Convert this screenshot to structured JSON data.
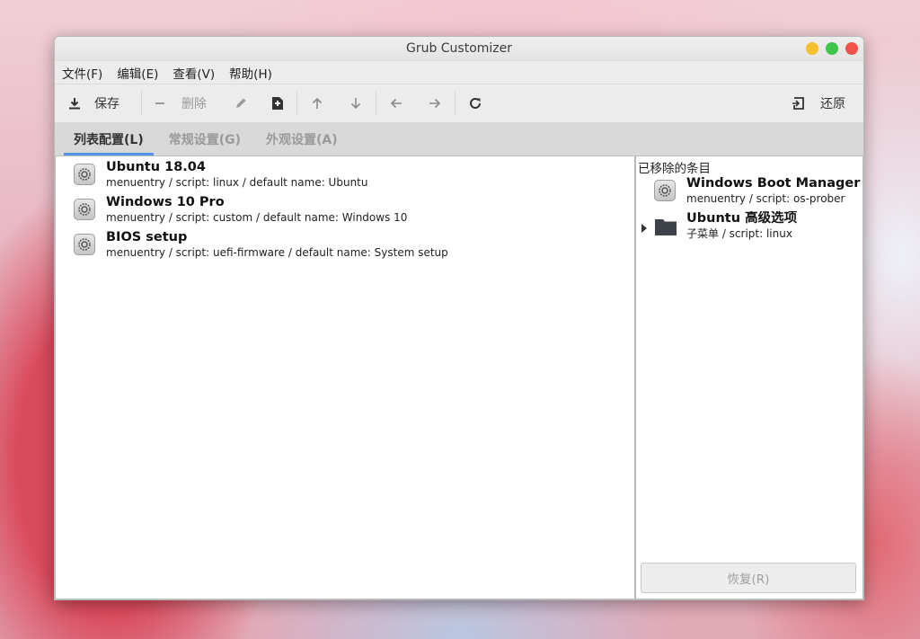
{
  "window": {
    "title": "Grub Customizer"
  },
  "menu": [
    "文件(F)",
    "编辑(E)",
    "查看(V)",
    "帮助(H)"
  ],
  "toolbar": {
    "save_label": "保存",
    "delete_label": "删除",
    "revert_label": "还原"
  },
  "tabs": [
    "列表配置(L)",
    "常规设置(G)",
    "外观设置(A)"
  ],
  "entries": [
    {
      "name": "Ubuntu 18.04",
      "detail": "menuentry / script: linux / default name: Ubuntu"
    },
    {
      "name": "Windows 10 Pro",
      "detail": "menuentry / script: custom / default name: Windows 10"
    },
    {
      "name": "BIOS setup",
      "detail": "menuentry / script: uefi-firmware / default name: System setup"
    }
  ],
  "removed": {
    "title": "已移除的条目",
    "items": [
      {
        "name": "Windows Boot Manager (…",
        "detail": "menuentry / script: os-prober"
      },
      {
        "name": "Ubuntu 高级选项",
        "detail": "子菜单 / script: linux"
      }
    ],
    "restore_label": "恢复(R)"
  }
}
